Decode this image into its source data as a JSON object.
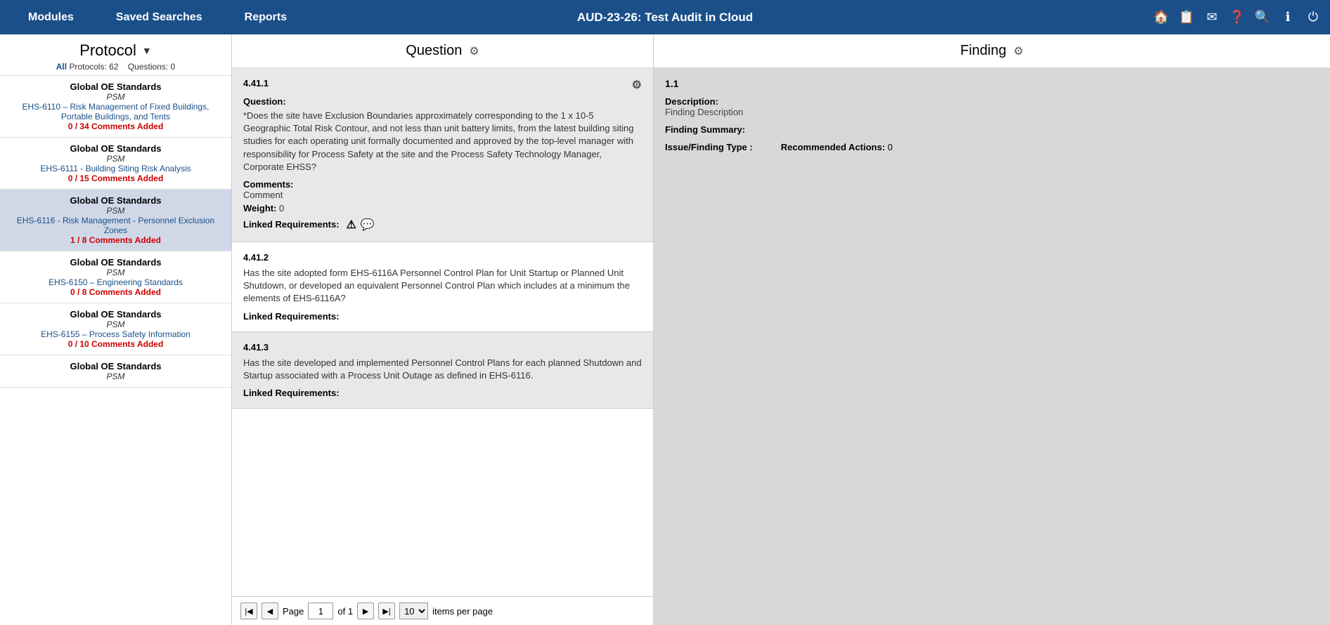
{
  "nav": {
    "modules_label": "Modules",
    "saved_searches_label": "Saved Searches",
    "reports_label": "Reports",
    "audit_title": "AUD-23-26: Test Audit in Cloud"
  },
  "left_panel": {
    "title": "Protocol",
    "all_label": "All",
    "protocols_count": "Protocols: 62",
    "questions_count": "Questions: 0",
    "items": [
      {
        "group": "Global OE Standards",
        "psm": "PSM",
        "name": "EHS-6110 – Risk Management of Fixed Buildings, Portable Buildings, and Tents",
        "comments": "0 / 34 Comments Added",
        "selected": false
      },
      {
        "group": "Global OE Standards",
        "psm": "PSM",
        "name": "EHS-6111 - Building Siting Risk Analysis",
        "comments": "0 / 15 Comments Added",
        "selected": false
      },
      {
        "group": "Global OE Standards",
        "psm": "PSM",
        "name": "EHS-6116 - Risk Management - Personnel Exclusion Zones",
        "comments": "1 / 8 Comments Added",
        "selected": true
      },
      {
        "group": "Global OE Standards",
        "psm": "PSM",
        "name": "EHS-6150 – Engineering Standards",
        "comments": "0 / 8 Comments Added",
        "selected": false
      },
      {
        "group": "Global OE Standards",
        "psm": "PSM",
        "name": "EHS-6155 – Process Safety Information",
        "comments": "0 / 10 Comments Added",
        "selected": false
      },
      {
        "group": "Global OE Standards",
        "psm": "PSM",
        "name": "",
        "comments": "",
        "selected": false
      }
    ]
  },
  "middle_panel": {
    "title": "Question",
    "questions": [
      {
        "number": "4.41.1",
        "label": "Question:",
        "text": "*Does the site have Exclusion Boundaries approximately corresponding to the 1 x 10-5 Geographic Total Risk Contour, and not less than unit battery limits, from the latest building siting studies for each operating unit formally documented and approved by the top-level manager with responsibility for Process Safety at the site and the Process Safety Technology Manager, Corporate EHSS?",
        "comments_label": "Comments:",
        "comments_value": "Comment",
        "weight_label": "Weight:",
        "weight_value": "0",
        "linked_label": "Linked Requirements:",
        "has_icons": true,
        "highlighted": true
      },
      {
        "number": "4.41.2",
        "text": "Has the site adopted form EHS-6116A Personnel Control Plan for Unit Startup or Planned Unit Shutdown, or developed an equivalent Personnel Control Plan which includes at a minimum the elements of EHS-6116A?",
        "linked_label": "Linked Requirements:",
        "has_icons": false,
        "highlighted": false
      },
      {
        "number": "4.41.3",
        "text": "Has the site developed and implemented Personnel Control Plans for each planned Shutdown and Startup associated with a Process Unit Outage as defined in EHS-6116.",
        "linked_label": "Linked Requirements:",
        "has_icons": false,
        "highlighted": false
      }
    ],
    "pagination": {
      "page_label": "Page",
      "current_page": "1",
      "of_label": "of 1",
      "items_label": "items per page",
      "per_page": "10"
    }
  },
  "right_panel": {
    "title": "Finding",
    "finding_number": "1.1",
    "description_label": "Description:",
    "description_value": "Finding Description",
    "summary_label": "Finding Summary:",
    "issue_label": "Issue/Finding Type :",
    "issue_value": "",
    "recommended_label": "Recommended Actions:",
    "recommended_value": "0"
  }
}
